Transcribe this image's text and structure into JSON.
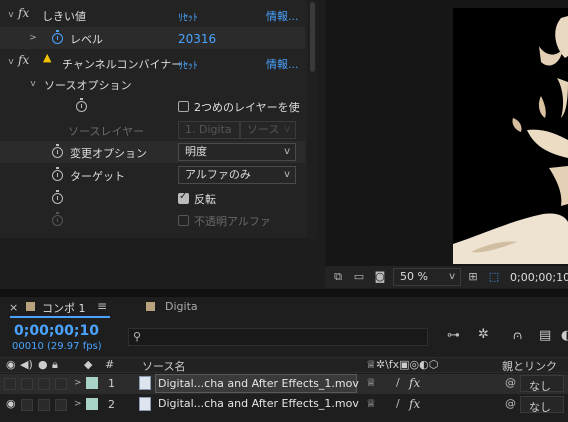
{
  "effect_controls": {
    "threshold_effect": {
      "name": "しきい値",
      "reset": "ﾘｾｯﾄ",
      "about": "情報..."
    },
    "level": {
      "label": "レベル",
      "value": "20316"
    },
    "channel_combiner": {
      "name": "チャンネルコンバイナー",
      "reset": "ﾘｾｯﾄ",
      "about": "情報..."
    },
    "source_options": {
      "label": "ソースオプション"
    },
    "use_two_layers": {
      "label": "2つめのレイヤーを使",
      "checked": false
    },
    "source_layer": {
      "label": "ソースレイヤー",
      "value": "1. Digita",
      "source": "ソース"
    },
    "change_option": {
      "label": "変更オプション",
      "value": "明度"
    },
    "target": {
      "label": "ターゲット",
      "value": "アルファのみ"
    },
    "invert": {
      "label": "反転",
      "checked": true
    },
    "opaque_alpha": {
      "label": "不透明アルファ",
      "checked": false
    }
  },
  "viewer": {
    "zoom": "50 %",
    "timecode": "0;00;00;10"
  },
  "timeline": {
    "tabs": [
      {
        "label": "コンポ 1",
        "active": true
      },
      {
        "label": "Digita",
        "active": false
      }
    ],
    "timecode": "0;00;00;10",
    "frame_info": "00010 (29.97 fps)",
    "search_placeholder": "",
    "columns": {
      "num": "#",
      "source": "ソース名",
      "parent": "親とリンク"
    },
    "layers": [
      {
        "num": "1",
        "name": "Digital...cha and After Effects_1.mov",
        "parent": "なし",
        "visible": false,
        "selected": true
      },
      {
        "num": "2",
        "name": "Digital...cha and After Effects_1.mov",
        "parent": "なし",
        "visible": true,
        "selected": false
      }
    ]
  },
  "colors": {
    "accent_blue": "#4aa3ff",
    "panel_bg": "#232323",
    "label_tan": "#b9a37e",
    "label_mint": "#a9d3c9"
  }
}
